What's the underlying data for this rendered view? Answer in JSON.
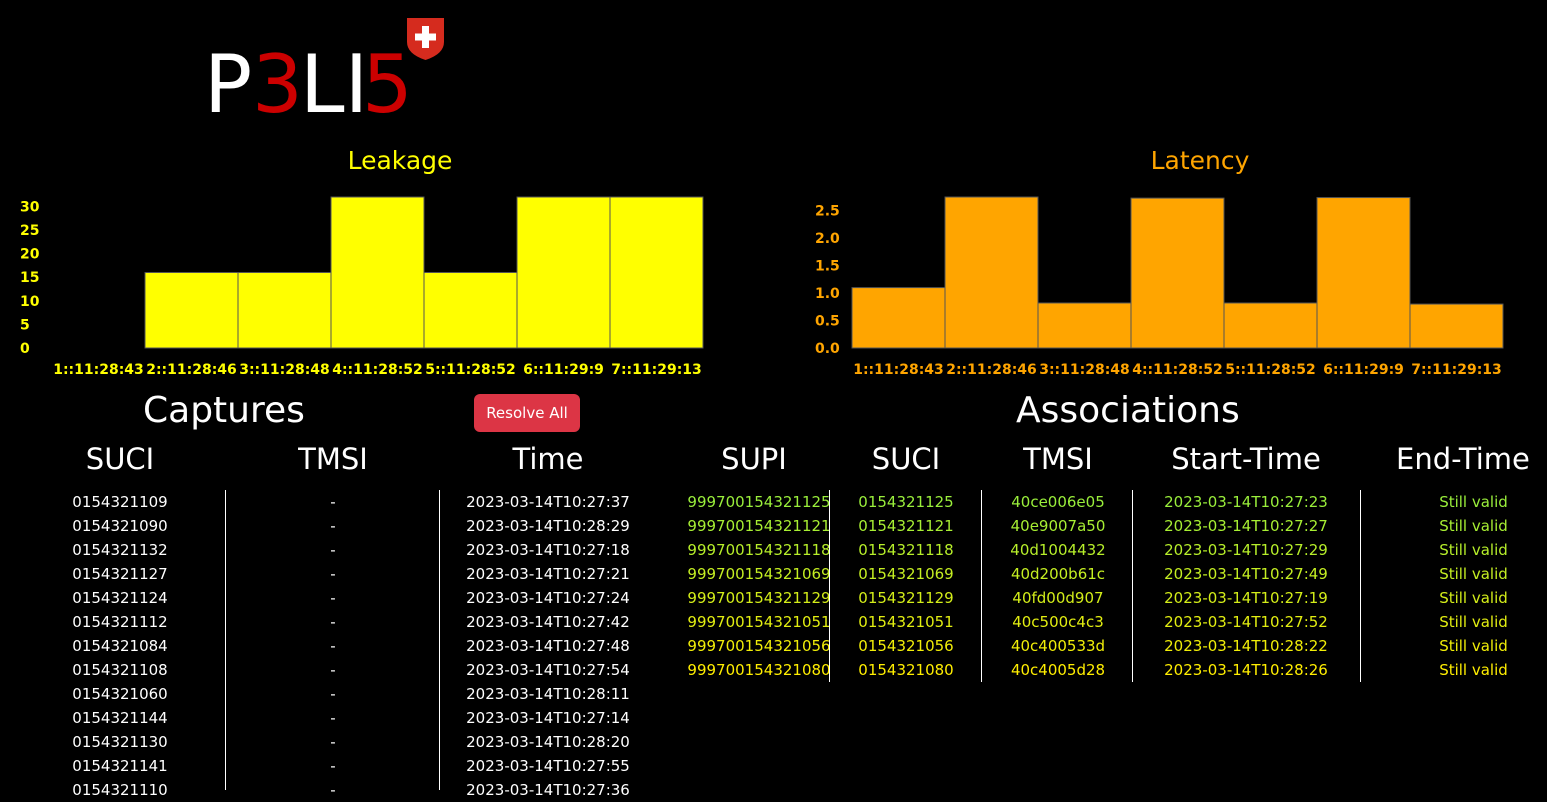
{
  "logo": {
    "text_prefix": "P",
    "text_mid": "3",
    "text_l": "LI",
    "text_end": "5"
  },
  "colors": {
    "leakage": "#ffff00",
    "latency": "#ffa500",
    "resolve_button": "#dc3545",
    "assoc_start": "#9aef3b",
    "assoc_end": "#ffee00"
  },
  "chart_data": [
    {
      "type": "bar",
      "title": "Leakage",
      "categories": [
        "1::11:28:43",
        "2::11:28:46",
        "3::11:28:48",
        "4::11:28:52",
        "5::11:28:52",
        "6::11:29:9",
        "7::11:29:13"
      ],
      "values": [
        0,
        16,
        16,
        32,
        16,
        32,
        32
      ],
      "yticks": [
        "0",
        "5",
        "10",
        "15",
        "20",
        "25",
        "30"
      ],
      "ylim": [
        0,
        32
      ],
      "xlabel": "",
      "ylabel": "",
      "grid": false
    },
    {
      "type": "bar",
      "title": "Latency",
      "categories": [
        "1::11:28:43",
        "2::11:28:46",
        "3::11:28:48",
        "4::11:28:52",
        "5::11:28:52",
        "6::11:29:9",
        "7::11:29:13"
      ],
      "values": [
        1.1,
        2.75,
        0.82,
        2.73,
        0.82,
        2.74,
        0.8
      ],
      "yticks": [
        "0.0",
        "0.5",
        "1.0",
        "1.5",
        "2.0",
        "2.5"
      ],
      "ylim": [
        0,
        2.75
      ],
      "xlabel": "",
      "ylabel": "",
      "grid": false
    }
  ],
  "captures": {
    "title": "Captures",
    "resolve_label": "Resolve All",
    "headers": {
      "suci": "SUCI",
      "tmsi": "TMSI",
      "time": "Time"
    },
    "rows": [
      {
        "suci": "0154321109",
        "tmsi": "-",
        "time": "2023-03-14T10:27:37"
      },
      {
        "suci": "0154321090",
        "tmsi": "-",
        "time": "2023-03-14T10:28:29"
      },
      {
        "suci": "0154321132",
        "tmsi": "-",
        "time": "2023-03-14T10:27:18"
      },
      {
        "suci": "0154321127",
        "tmsi": "-",
        "time": "2023-03-14T10:27:21"
      },
      {
        "suci": "0154321124",
        "tmsi": "-",
        "time": "2023-03-14T10:27:24"
      },
      {
        "suci": "0154321112",
        "tmsi": "-",
        "time": "2023-03-14T10:27:42"
      },
      {
        "suci": "0154321084",
        "tmsi": "-",
        "time": "2023-03-14T10:27:48"
      },
      {
        "suci": "0154321108",
        "tmsi": "-",
        "time": "2023-03-14T10:27:54"
      },
      {
        "suci": "0154321060",
        "tmsi": "-",
        "time": "2023-03-14T10:28:11"
      },
      {
        "suci": "0154321144",
        "tmsi": "-",
        "time": "2023-03-14T10:27:14"
      },
      {
        "suci": "0154321130",
        "tmsi": "-",
        "time": "2023-03-14T10:28:20"
      },
      {
        "suci": "0154321141",
        "tmsi": "-",
        "time": "2023-03-14T10:27:55"
      },
      {
        "suci": "0154321110",
        "tmsi": "-",
        "time": "2023-03-14T10:27:36"
      }
    ]
  },
  "associations": {
    "title": "Associations",
    "headers": {
      "supi": "SUPI",
      "suci": "SUCI",
      "tmsi": "TMSI",
      "start": "Start-Time",
      "end": "End-Time"
    },
    "rows": [
      {
        "supi": "999700154321125",
        "suci": "0154321125",
        "tmsi": "40ce006e05",
        "start": "2023-03-14T10:27:23",
        "end": "Still valid"
      },
      {
        "supi": "999700154321121",
        "suci": "0154321121",
        "tmsi": "40e9007a50",
        "start": "2023-03-14T10:27:27",
        "end": "Still valid"
      },
      {
        "supi": "999700154321118",
        "suci": "0154321118",
        "tmsi": "40d1004432",
        "start": "2023-03-14T10:27:29",
        "end": "Still valid"
      },
      {
        "supi": "999700154321069",
        "suci": "0154321069",
        "tmsi": "40d200b61c",
        "start": "2023-03-14T10:27:49",
        "end": "Still valid"
      },
      {
        "supi": "999700154321129",
        "suci": "0154321129",
        "tmsi": "40fd00d907",
        "start": "2023-03-14T10:27:19",
        "end": "Still valid"
      },
      {
        "supi": "999700154321051",
        "suci": "0154321051",
        "tmsi": "40c500c4c3",
        "start": "2023-03-14T10:27:52",
        "end": "Still valid"
      },
      {
        "supi": "999700154321056",
        "suci": "0154321056",
        "tmsi": "40c400533d",
        "start": "2023-03-14T10:28:22",
        "end": "Still valid"
      },
      {
        "supi": "999700154321080",
        "suci": "0154321080",
        "tmsi": "40c4005d28",
        "start": "2023-03-14T10:28:26",
        "end": "Still valid"
      }
    ]
  }
}
